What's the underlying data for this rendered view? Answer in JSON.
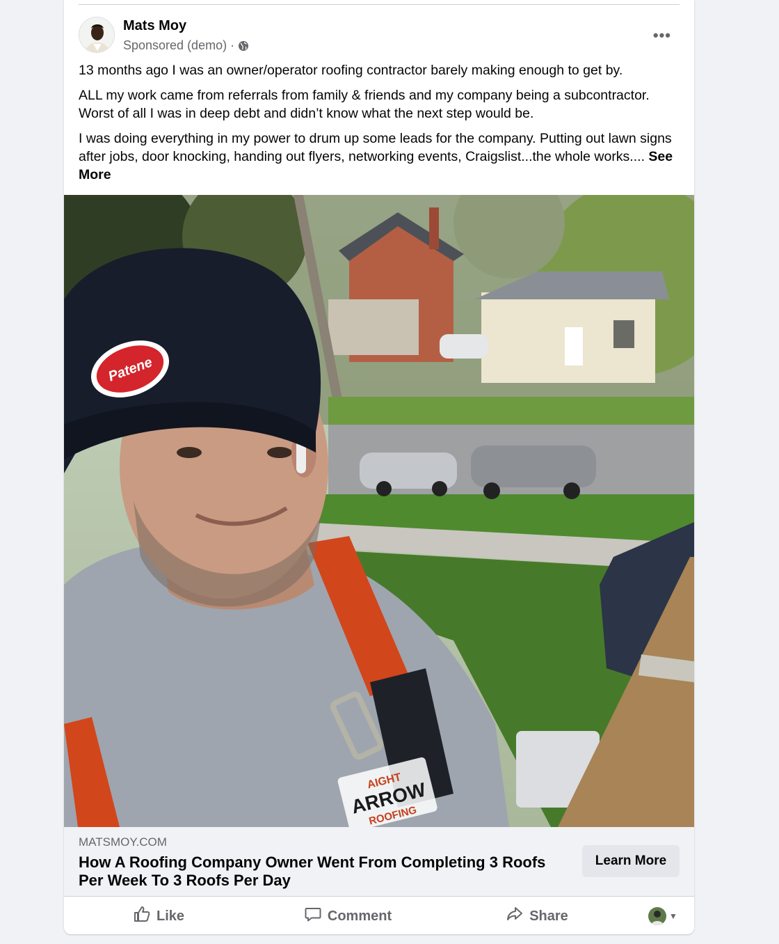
{
  "post": {
    "author": "Mats Moy",
    "sponsored_label": "Sponsored (demo)",
    "separator": "·",
    "more_label": "•••",
    "paragraphs": [
      "13 months ago I was an owner/operator roofing contractor barely making enough to get by.",
      "ALL my work came from referrals from family & friends and my company being a subcontractor. Worst of all I was in deep debt and didn’t know what the next step would be.",
      "I was doing everything in my power to drum up some leads for the company. Putting out lawn signs after jobs, door knocking, handing out flyers, networking events, Craigslist...the whole works...."
    ],
    "see_more": "See More"
  },
  "photo": {
    "beanie_logo": "Patene",
    "shirt_line1": "AIGHT",
    "shirt_line2": "ARROW",
    "shirt_line3": "ROOFING"
  },
  "link": {
    "domain": "MATSMOY.COM",
    "headline": "How A Roofing Company Owner Went From Completing 3 Roofs Per Week To 3 Roofs Per Day",
    "cta": "Learn More"
  },
  "actions": {
    "like": "Like",
    "comment": "Comment",
    "share": "Share",
    "caret": "▼"
  },
  "icons": {
    "globe": "globe-icon",
    "like": "thumbs-up-icon",
    "comment": "speech-bubble-icon",
    "share": "share-arrow-icon",
    "more": "ellipsis-icon"
  },
  "colors": {
    "text": "#050505",
    "secondary": "#65676b",
    "card": "#ffffff",
    "background": "#f0f2f5",
    "button": "#e4e6eb"
  }
}
